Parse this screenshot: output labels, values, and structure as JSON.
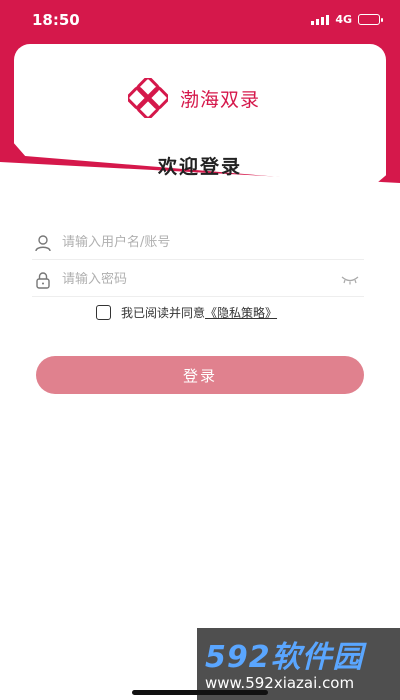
{
  "status_bar": {
    "time": "18:50",
    "network": "4G"
  },
  "brand": {
    "name": "渤海双录",
    "logo_icon": "knot-logo-icon",
    "color": "#d5184b"
  },
  "page_title": "欢迎登录",
  "form": {
    "username": {
      "value": "",
      "placeholder": "请输入用户名/账号",
      "icon": "user-icon"
    },
    "password": {
      "value": "",
      "placeholder": "请输入密码",
      "icon": "lock-icon",
      "toggle_icon": "eye-closed-icon"
    }
  },
  "agreement": {
    "text": "我已阅读并同意",
    "link": "《隐私策略》",
    "checked": false
  },
  "login_button": {
    "label": "登录",
    "color": "#e0818e"
  },
  "watermark": {
    "title": "592软件园",
    "url": "www.592xiazai.com"
  }
}
